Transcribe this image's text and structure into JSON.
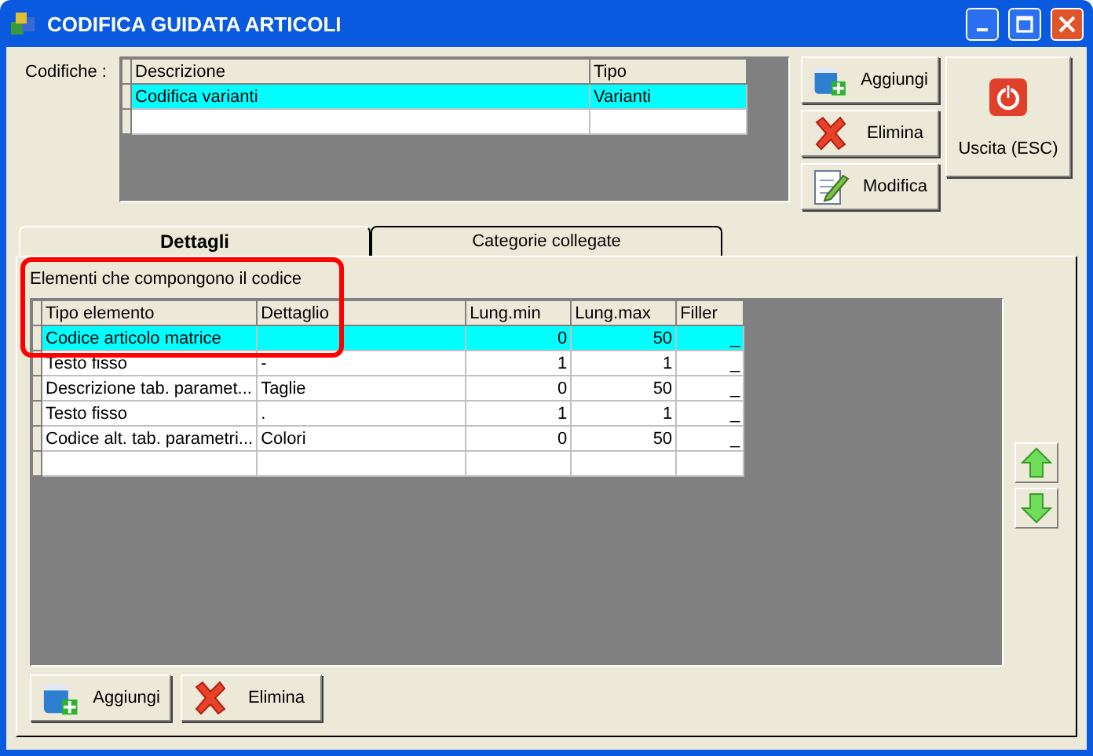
{
  "window": {
    "title": "CODIFICA GUIDATA ARTICOLI"
  },
  "codifiche": {
    "label": "Codifiche :",
    "columns": [
      "Descrizione",
      "Tipo"
    ],
    "rows": [
      {
        "cells": [
          "Codifica varianti",
          "Varianti"
        ],
        "selected": true
      }
    ]
  },
  "buttons": [
    "Aggiungi",
    "Elimina",
    "Modifica"
  ],
  "exit_button": "Uscita (ESC)",
  "tabs": [
    {
      "label": "Dettagli",
      "selected": true
    },
    {
      "label": "Categorie collegate",
      "selected": false
    }
  ],
  "details": {
    "caption": "Elementi che compongono il codice",
    "columns": [
      "Tipo elemento",
      "Dettaglio",
      "Lung.min",
      "Lung.max",
      "Filler"
    ],
    "rows": [
      {
        "cells": [
          "Codice articolo matrice",
          "",
          "0",
          "50",
          "_"
        ],
        "selected": true
      },
      {
        "cells": [
          "Testo fisso",
          "-",
          "1",
          "1",
          "_"
        ],
        "selected": false
      },
      {
        "cells": [
          "Descrizione tab. paramet...",
          "Taglie",
          "0",
          "50",
          "_"
        ],
        "selected": false
      },
      {
        "cells": [
          "Testo fisso",
          ".",
          "1",
          "1",
          "_"
        ],
        "selected": false
      },
      {
        "cells": [
          "Codice alt. tab. parametri...",
          "Colori",
          "0",
          "50",
          "_"
        ],
        "selected": false
      }
    ]
  },
  "bottom_buttons": [
    "Aggiungi",
    "Elimina"
  ]
}
